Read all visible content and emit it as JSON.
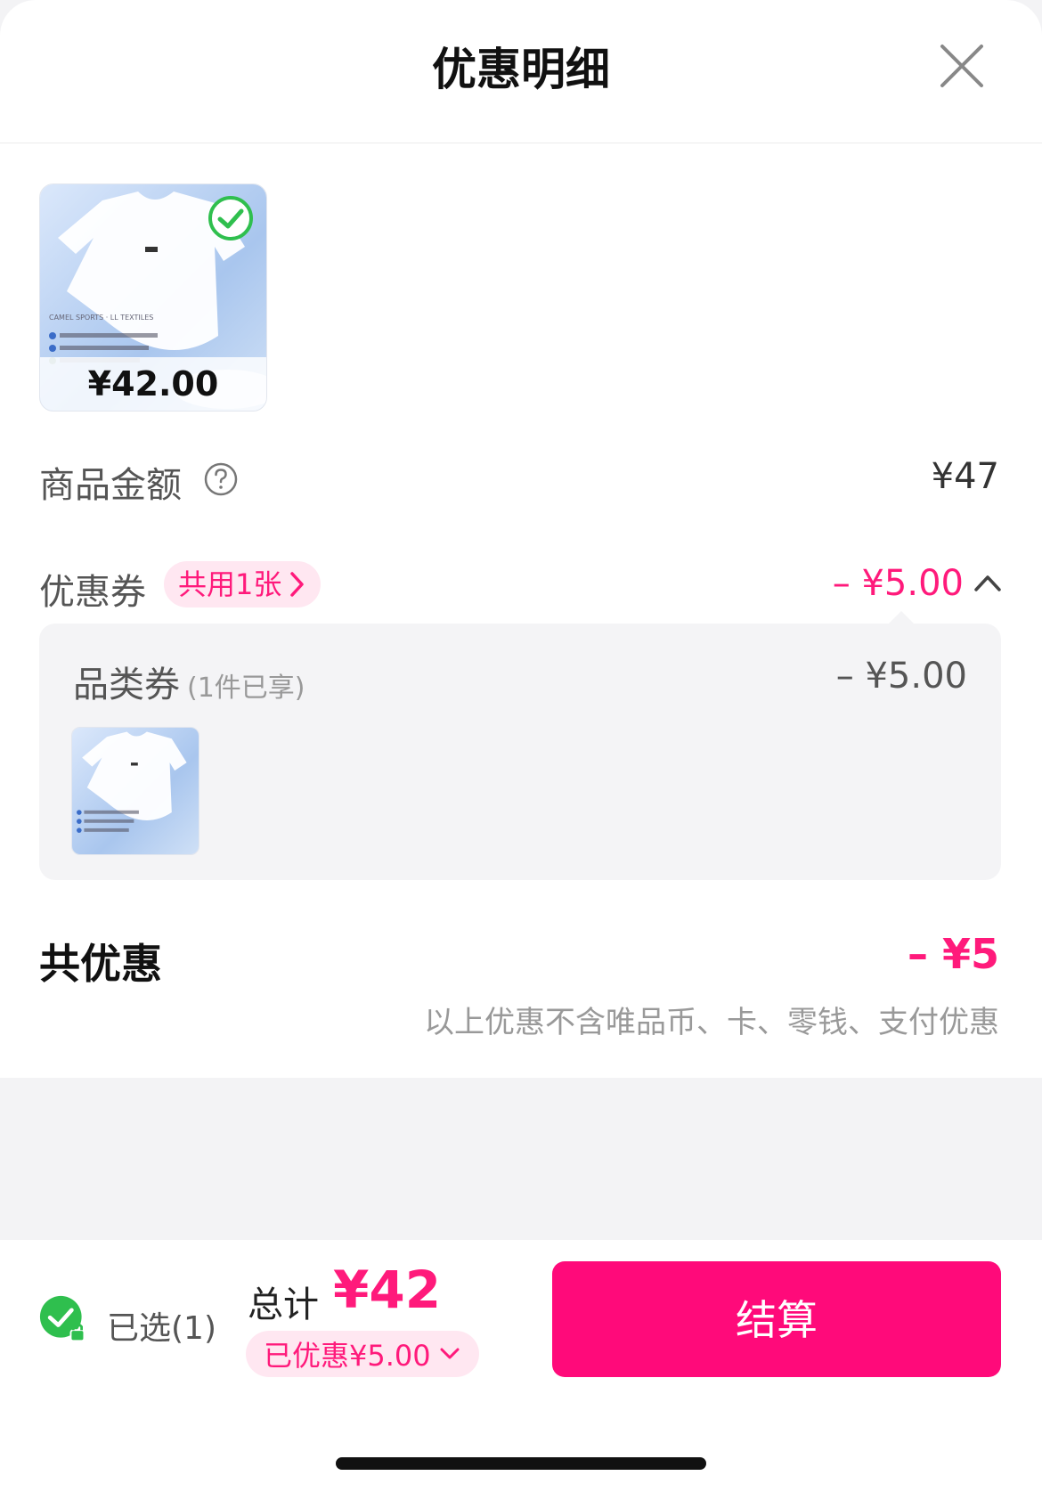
{
  "header": {
    "title": "优惠明细"
  },
  "product": {
    "price": "¥42.00"
  },
  "goods_amount": {
    "label": "商品金额",
    "value": "¥47"
  },
  "coupon": {
    "label": "优惠券",
    "pill": "共用1张",
    "value": "– ¥5.00",
    "detail": {
      "name": "品类券",
      "note": "(1件已享)",
      "value": "– ¥5.00"
    }
  },
  "total_discount": {
    "label": "共优惠",
    "value": "– ¥5",
    "note": "以上优惠不含唯品币、卡、零钱、支付优惠"
  },
  "footer": {
    "selected": "已选(1)",
    "total_label": "总计",
    "total_value": "¥42",
    "discount": "已优惠¥5.00",
    "checkout": "结算"
  },
  "colors": {
    "accent": "#ff0a7a",
    "check_green": "#2fbf4e"
  }
}
